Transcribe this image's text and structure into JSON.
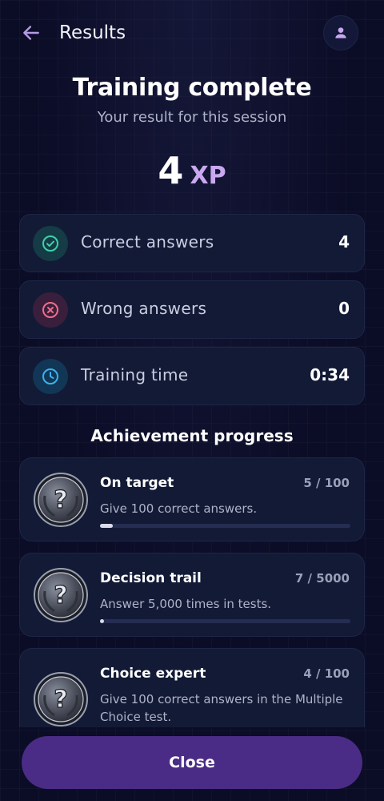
{
  "header": {
    "title": "Results",
    "back_icon": "arrow-left-icon",
    "profile_icon": "person-icon"
  },
  "hero": {
    "title": "Training complete",
    "subtitle": "Your result for this session",
    "xp_value": "4",
    "xp_unit": "XP"
  },
  "stats": [
    {
      "label": "Correct answers",
      "value": "4",
      "icon": "check-circle-icon",
      "color": "#3fd1a6"
    },
    {
      "label": "Wrong answers",
      "value": "0",
      "icon": "x-circle-icon",
      "color": "#ef6d8a"
    },
    {
      "label": "Training time",
      "value": "0:34",
      "icon": "clock-icon",
      "color": "#3ab2ec"
    }
  ],
  "achievements": {
    "title": "Achievement progress",
    "items": [
      {
        "name": "On target",
        "count": "5 / 100",
        "description": "Give 100 correct answers.",
        "progress": 0.05,
        "badge": "question-mark-laurel-badge-icon"
      },
      {
        "name": "Decision trail",
        "count": "7 / 5000",
        "description": "Answer 5,000 times in tests.",
        "progress": 0.0014,
        "badge": "question-mark-laurel-badge-icon"
      },
      {
        "name": "Choice expert",
        "count": "4 / 100",
        "description": "Give 100 correct answers in the Multiple Choice test.",
        "progress": 0.04,
        "badge": "question-mark-laurel-badge-icon"
      }
    ]
  },
  "footer": {
    "close_label": "Close"
  },
  "colors": {
    "accent": "#c9a8f0",
    "button": "#4a2c86",
    "card": "#131a36",
    "background": "#0b0c26"
  }
}
